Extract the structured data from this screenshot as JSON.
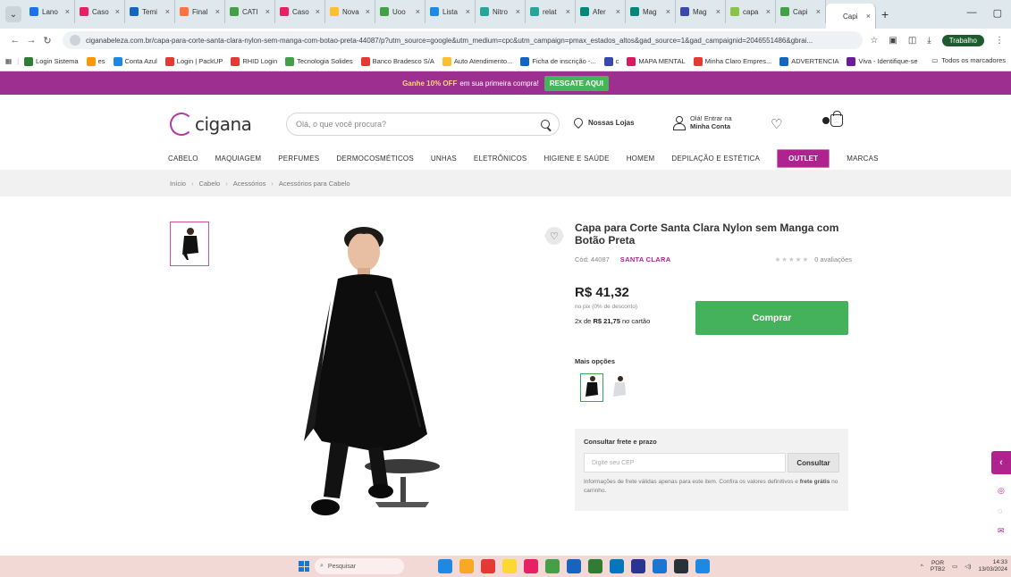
{
  "browser": {
    "tabs": [
      {
        "label": "Lano",
        "color": "#1a73e8"
      },
      {
        "label": "Caso",
        "color": "#e91e63"
      },
      {
        "label": "Temi",
        "color": "#1565c0"
      },
      {
        "label": "Final",
        "color": "#ff7043"
      },
      {
        "label": "CATI",
        "color": "#43a047"
      },
      {
        "label": "Caso",
        "color": "#e91e63"
      },
      {
        "label": "Nova",
        "color": "#fbc02d"
      },
      {
        "label": "Uoo",
        "color": "#43a047"
      },
      {
        "label": "Lista",
        "color": "#1e88e5"
      },
      {
        "label": "Nitro",
        "color": "#26a69a"
      },
      {
        "label": "relat",
        "color": "#26a69a"
      },
      {
        "label": "Afer",
        "color": "#00897b"
      },
      {
        "label": "Mag",
        "color": "#00897b"
      },
      {
        "label": "Mag",
        "color": "#3949ab"
      },
      {
        "label": "capa",
        "color": "#8bc34a"
      },
      {
        "label": "Capi",
        "color": "#43a047"
      },
      {
        "label": "Capi",
        "color": "#ffffff",
        "active": true
      }
    ],
    "url": "ciganabeleza.com.br/capa-para-corte-santa-clara-nylon-sem-manga-com-botao-preta-44087/p?utm_source=google&utm_medium=cpc&utm_campaign=pmax_estados_altos&gad_source=1&gad_campaignid=2046551486&gbrai...",
    "profile": "Trabalho",
    "bookmarks": [
      {
        "label": "Login Sistema",
        "color": "#2e7d32"
      },
      {
        "label": "es",
        "color": "#ff9800"
      },
      {
        "label": "Conta Azul",
        "color": "#1e88e5"
      },
      {
        "label": "Login | PackUP",
        "color": "#e53935"
      },
      {
        "label": "RHID Login",
        "color": "#e53935"
      },
      {
        "label": "Tecnologia Solides",
        "color": "#43a047"
      },
      {
        "label": "Banco Bradesco S/A",
        "color": "#e53935"
      },
      {
        "label": "Auto Atendimento...",
        "color": "#fbc02d"
      },
      {
        "label": "Ficha de inscrição -...",
        "color": "#1565c0"
      },
      {
        "label": "c",
        "color": "#3949ab"
      },
      {
        "label": "MAPA MENTAL",
        "color": "#d81b60"
      },
      {
        "label": "Minha Claro Empres...",
        "color": "#e53935"
      },
      {
        "label": "ADVERTENCIA",
        "color": "#1565c0"
      },
      {
        "label": "Viva - Identifique-se",
        "color": "#6a1b9a"
      }
    ],
    "all_bookmarks": "Todos os marcadores"
  },
  "promo": {
    "text_bold": "Ganhe 10% OFF",
    "text": "em sua primeira compra!",
    "button": "RESGATE AQUI"
  },
  "header": {
    "logo": "cigana",
    "search_placeholder": "Olá, o que você procura?",
    "stores": "Nossas Lojas",
    "account_line1": "Olá! Entrar na",
    "account_line2": "Minha Conta"
  },
  "nav": [
    "CABELO",
    "MAQUIAGEM",
    "PERFUMES",
    "DERMOCOSMÉTICOS",
    "UNHAS",
    "ELETRÔNICOS",
    "HIGIENE E SAÚDE",
    "HOMEM",
    "DEPILAÇÃO E ESTÉTICA",
    "OUTLET",
    "MARCAS"
  ],
  "breadcrumbs": [
    "Início",
    "Cabelo",
    "Acessórios",
    "Acessórios para Cabelo"
  ],
  "product": {
    "title": "Capa para Corte Santa Clara Nylon sem Manga com Botão Preta",
    "code": "Cód: 44087",
    "brand": "SANTA CLARA",
    "stars": "★★★★★",
    "reviews": "0 avaliações",
    "price": "R$ 41,32",
    "pix_note": "no pix (0% de desconto)",
    "installments_prefix": "2x de",
    "installments_value": "R$ 21,75",
    "installments_suffix": "no cartão",
    "buy_button": "Comprar",
    "more_options": "Mais opções"
  },
  "shipping": {
    "title": "Consultar frete e prazo",
    "placeholder": "Digite seu CEP",
    "button": "Consultar",
    "note": "Informações de frete válidas apenas para este item. Confira os valores definitivos e",
    "note_bold": "frete grátis",
    "note_end": "no carrinho."
  },
  "taskbar": {
    "search": "Pesquisar",
    "lang1": "POR",
    "lang2": "PTB2",
    "time": "14:33",
    "date": "13/03/2024"
  },
  "colors": {
    "brand": "#b0238f",
    "buy": "#44b25a",
    "promo_bg": "#9c2f8f"
  }
}
